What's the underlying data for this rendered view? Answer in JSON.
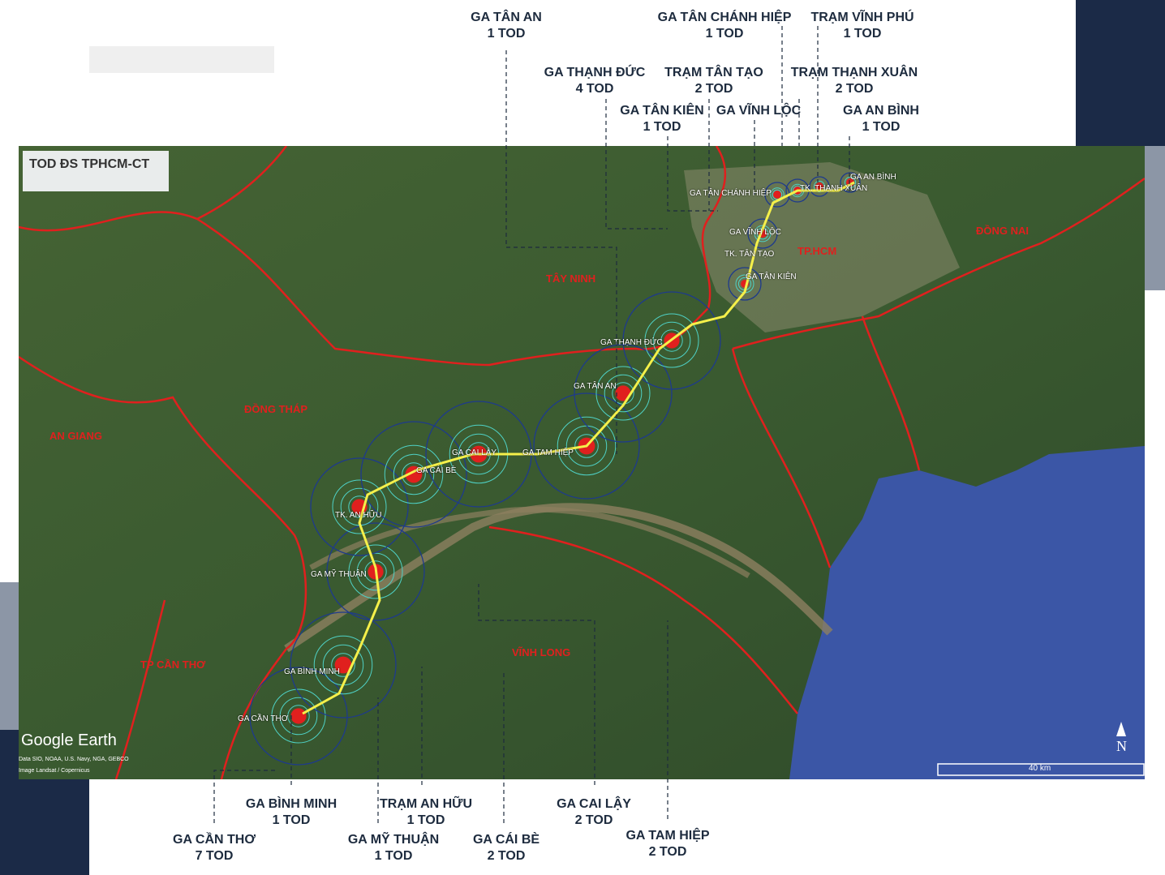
{
  "title": "TOD ĐS TPHCM-CT",
  "watermark": "Google Earth",
  "credits": [
    "Data SIO, NOAA, U.S. Navy, NGA, GEBCO",
    "Image Landsat / Copernicus"
  ],
  "scale_label": "40 km",
  "north_label": "N",
  "provinces": [
    "TÂY NINH",
    "ĐỒNG THÁP",
    "AN GIANG",
    "TP CẦN THƠ",
    "VĨNH LONG",
    "TP.HCM",
    "ĐỒNG NAI"
  ],
  "map_stations": [
    "GA TÂN CHÁNH HIỆP",
    "TK. THẠNH XUÂN",
    "GA AN BÌNH",
    "GA VĨNH LỘC",
    "TK. TÂN TẠO",
    "GA TÂN KIÊN",
    "GA THẠNH ĐỨC",
    "GA TÂN AN",
    "GA TAM HIỆP",
    "GA CAI LẬY",
    "GA CÁI BÈ",
    "TK. AN HỮU",
    "GA MỸ THUẬN",
    "GA BÌNH MINH",
    "GA CẦN THƠ"
  ],
  "callouts": [
    {
      "name": "GA TÂN AN",
      "tod": "1 TOD"
    },
    {
      "name": "GA TÂN CHÁNH HIỆP",
      "tod": "1 TOD"
    },
    {
      "name": "TRẠM VĨNH PHÚ",
      "tod": "1 TOD"
    },
    {
      "name": "GA THẠNH ĐỨC",
      "tod": "4 TOD"
    },
    {
      "name": "TRẠM TÂN TẠO",
      "tod": "2 TOD"
    },
    {
      "name": "TRẠM THẠNH XUÂN",
      "tod": "2 TOD"
    },
    {
      "name": "GA TÂN KIÊN",
      "tod": "1 TOD"
    },
    {
      "name": "GA VĨNH LỘC",
      "tod": ""
    },
    {
      "name": "GA AN BÌNH",
      "tod": "1 TOD"
    },
    {
      "name": "GA BÌNH MINH",
      "tod": "1 TOD"
    },
    {
      "name": "TRẠM AN HỮU",
      "tod": "1 TOD"
    },
    {
      "name": "GA CẦN THƠ",
      "tod": "7 TOD"
    },
    {
      "name": "GA MỸ THUẬN",
      "tod": "1 TOD"
    },
    {
      "name": "GA CÁI BÈ",
      "tod": "2 TOD"
    },
    {
      "name": "GA CAI LẬY",
      "tod": "2 TOD"
    },
    {
      "name": "GA TAM HIỆP",
      "tod": "2 TOD"
    }
  ],
  "colors": {
    "navy": "#1b2a47",
    "boundary": "#e0201e",
    "railway": "#f5f04a",
    "land": "#3c5a2e",
    "sea": "#3b56a6"
  }
}
